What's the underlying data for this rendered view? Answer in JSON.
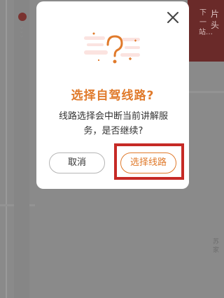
{
  "background": {
    "side_panel_title": "片头",
    "side_panel_sub": "下一站…",
    "bottom_right_text": "苏家"
  },
  "dialog": {
    "title": "选择自驾线路?",
    "message": "线路选择会中断当前讲解服务，是否继续?",
    "cancel_label": "取消",
    "confirm_label": "选择线路",
    "close_icon": "close-icon",
    "illustration_icon": "question-mark-illustration"
  },
  "colors": {
    "accent": "#e07a2b",
    "highlight": "#c62a26",
    "side_panel": "#6a2a29"
  }
}
